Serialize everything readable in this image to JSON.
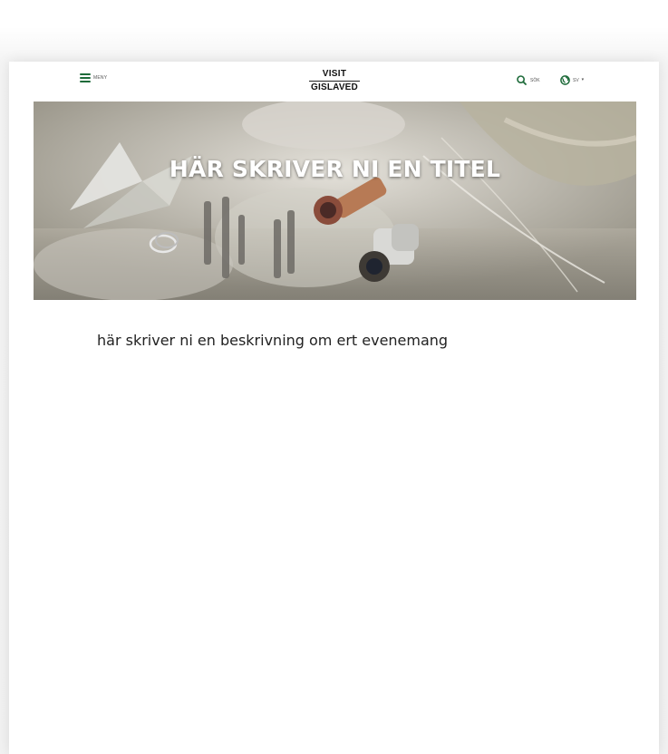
{
  "header": {
    "menu_label": "MENY",
    "logo_top": "VISIT",
    "logo_bottom": "GISLAVED",
    "search_label": "SÖK",
    "language_label": "SV",
    "accent_color": "#1e6b3a"
  },
  "hero": {
    "title": "HÄR SKRIVER NI EN TITEL"
  },
  "content": {
    "description": "här skriver ni en beskrivning om ert evenemang"
  },
  "icons": {
    "menu": "hamburger-icon",
    "search": "search-icon",
    "language": "globe-icon",
    "dropdown": "chevron-down-icon"
  }
}
